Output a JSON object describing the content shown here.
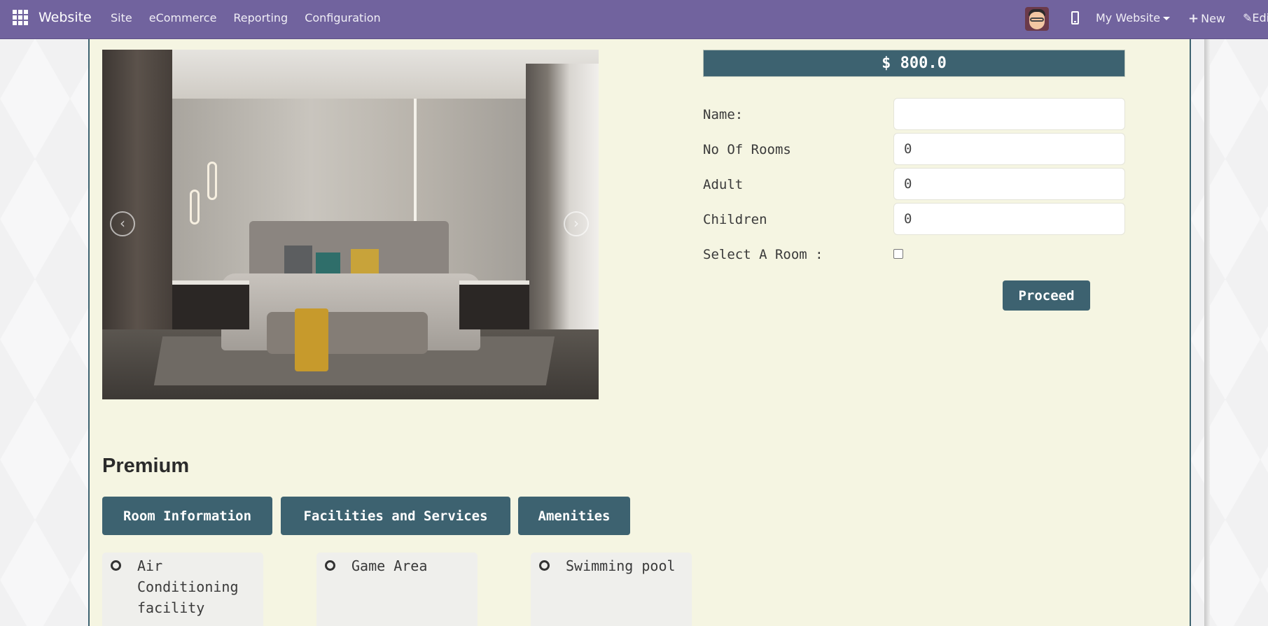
{
  "navbar": {
    "app_name": "Website",
    "menu": [
      "Site",
      "eCommerce",
      "Reporting",
      "Configuration"
    ],
    "website_selector": "My Website",
    "new_label": "New",
    "edit_label": "Edit",
    "icons": {
      "apps": "apps-grid-icon",
      "avatar": "user-avatar",
      "mobile": "mobile-preview-icon",
      "new": "plus-icon",
      "edit": "pencil-icon"
    },
    "color": "#71639e"
  },
  "room": {
    "image_alt": "Premium bedroom photo",
    "carousel": {
      "prev_icon": "‹",
      "next_icon": "›"
    },
    "price": "$ 800.0",
    "accent_color": "#3d6270"
  },
  "form": {
    "fields": [
      {
        "label": "Name:",
        "value": ""
      },
      {
        "label": "No Of Rooms",
        "value": "0"
      },
      {
        "label": "Adult",
        "value": "0"
      },
      {
        "label": "Children",
        "value": "0"
      }
    ],
    "select_room_label": "Select A Room :",
    "select_room_checked": false,
    "proceed_label": "Proceed"
  },
  "premium": {
    "title": "Premium",
    "tabs": [
      "Room Information",
      "Facilities and Services",
      "Amenities"
    ],
    "amenities": [
      "Air Conditioning facility",
      "Game Area",
      "Swimming pool"
    ]
  }
}
